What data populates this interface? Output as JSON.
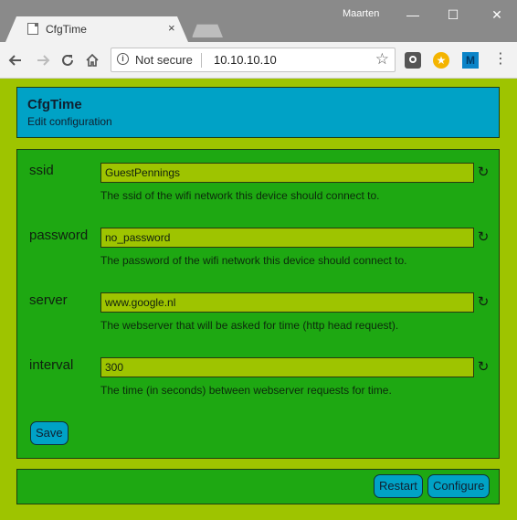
{
  "browser": {
    "user": "Maarten",
    "tab_title": "CfgTime",
    "tab_close": "×",
    "security_label": "Not secure",
    "url": "10.10.10.10",
    "window_controls": {
      "minimize": "—",
      "maximize": "☐",
      "close": "✕"
    }
  },
  "page": {
    "header": {
      "title": "CfgTime",
      "subtitle": "Edit configuration"
    },
    "fields": [
      {
        "label": "ssid",
        "value": "GuestPennings",
        "help": "The ssid of the wifi network this device should connect to."
      },
      {
        "label": "password",
        "value": "no_password",
        "help": "The password of the wifi network this device should connect to."
      },
      {
        "label": "server",
        "value": "www.google.nl",
        "help": "The webserver that will be asked for time (http head request)."
      },
      {
        "label": "interval",
        "value": "300",
        "help": "The time (in seconds) between webserver requests for time."
      }
    ],
    "save_label": "Save",
    "footer": {
      "restart_label": "Restart",
      "configure_label": "Configure"
    }
  },
  "colors": {
    "page_background": "#9ec400",
    "panel_green": "#1ea812",
    "header_blue": "#00a2c6",
    "input_background": "#9ec400"
  },
  "icons": [
    "info-icon",
    "star-icon",
    "reload-icon",
    "back-icon",
    "forward-icon",
    "home-icon",
    "reset-icon",
    "menu-icon"
  ]
}
